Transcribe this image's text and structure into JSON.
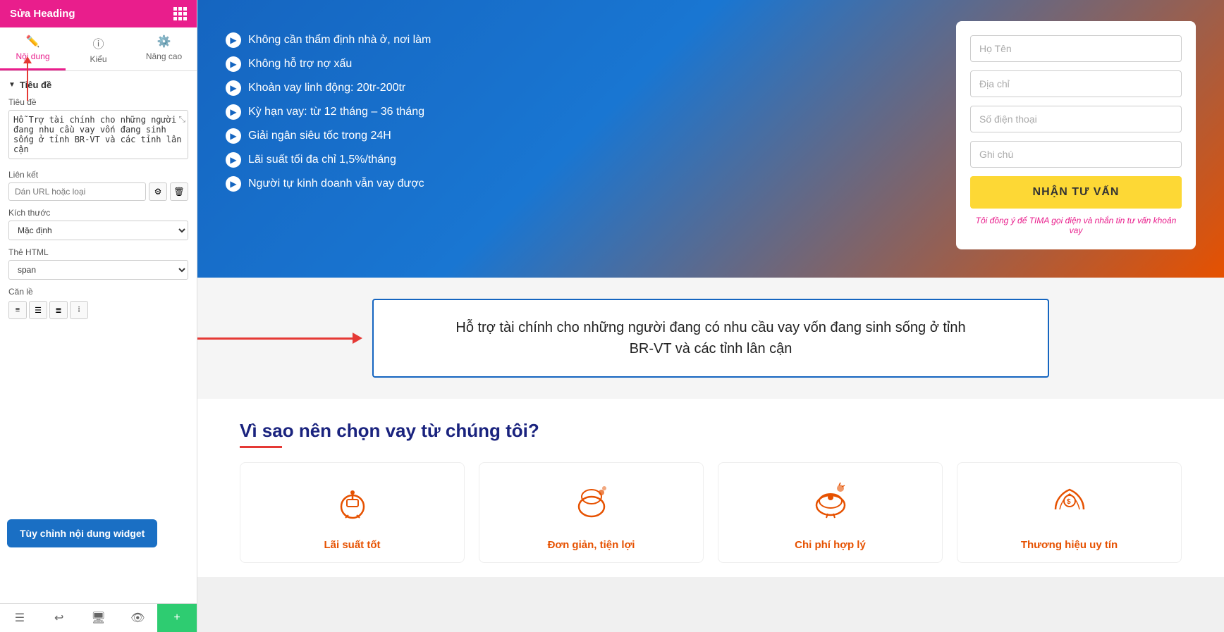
{
  "header": {
    "title": "Sửa Heading",
    "grid_icon": "grid-icon"
  },
  "tabs": [
    {
      "id": "noidung",
      "label": "Nội dung",
      "icon": "✏️",
      "active": true
    },
    {
      "id": "kieu",
      "label": "Kiểu",
      "icon": "ⓘ",
      "active": false
    },
    {
      "id": "nangcao",
      "label": "Nâng cao",
      "icon": "⚙️",
      "active": false
    }
  ],
  "sections": {
    "tieude_label": "Tiêu đề",
    "tieude_field_label": "Tiêu đề",
    "tieude_value": "Hỗ Trợ tài chính cho những người đang nhu cầu vay vốn đang sinh sống ở tỉnh BR-VT và các tỉnh lân cận",
    "lienket_label": "Liên kết",
    "lienket_placeholder": "Dán URL hoặc loại",
    "kichthuoc_label": "Kích thước",
    "kichthuoc_value": "Mặc định",
    "the_html_label": "Thẻ HTML",
    "the_html_value": "span",
    "can_le_label": "Căn lề"
  },
  "tooltip": "Tùy chỉnh nội dung widget",
  "hero": {
    "features": [
      "Không cần thẩm định nhà ở, nơi làm",
      "Không hỗ trợ nợ xấu",
      "Khoản vay linh động: 20tr-200tr",
      "Kỳ hạn vay: từ 12 tháng – 36 tháng",
      "Giải ngân siêu tốc trong 24H",
      "Lãi suất tối đa chỉ 1,5%/tháng",
      "Người tự kinh doanh vẫn vay được"
    ],
    "form": {
      "ho_ten_placeholder": "Họ Tên",
      "dia_chi_placeholder": "Địa chỉ",
      "so_dien_thoai_placeholder": "Số điện thoại",
      "ghi_chu_placeholder": "Ghi chú",
      "button_label": "NHẬN TƯ VẤN",
      "consent_text": "Tôi đồng ý để TIMA gọi điện và nhắn tin tư vấn khoản vay"
    }
  },
  "heading_box": {
    "text_line1": "Hỗ trợ tài chính cho những người đang có nhu cầu vay vốn đang sinh sống ở tỉnh",
    "text_line2": "BR-VT và các tỉnh lân cận"
  },
  "why_section": {
    "title": "Vì sao nên chọn vay từ chúng tôi?",
    "cards": [
      {
        "icon": "💰",
        "title": "Lãi suất tốt"
      },
      {
        "icon": "👜",
        "title": "Đơn giản, tiện lợi"
      },
      {
        "icon": "🐷",
        "title": "Chi phí hợp lý"
      },
      {
        "icon": "🤝",
        "title": "Thương hiệu uy tín"
      }
    ]
  },
  "footer_buttons": [
    {
      "icon": "☰",
      "label": "layers"
    },
    {
      "icon": "↩",
      "label": "undo"
    },
    {
      "icon": "🖥",
      "label": "desktop"
    },
    {
      "icon": "👁",
      "label": "preview"
    },
    {
      "icon": "+",
      "label": "add",
      "green": true
    }
  ]
}
